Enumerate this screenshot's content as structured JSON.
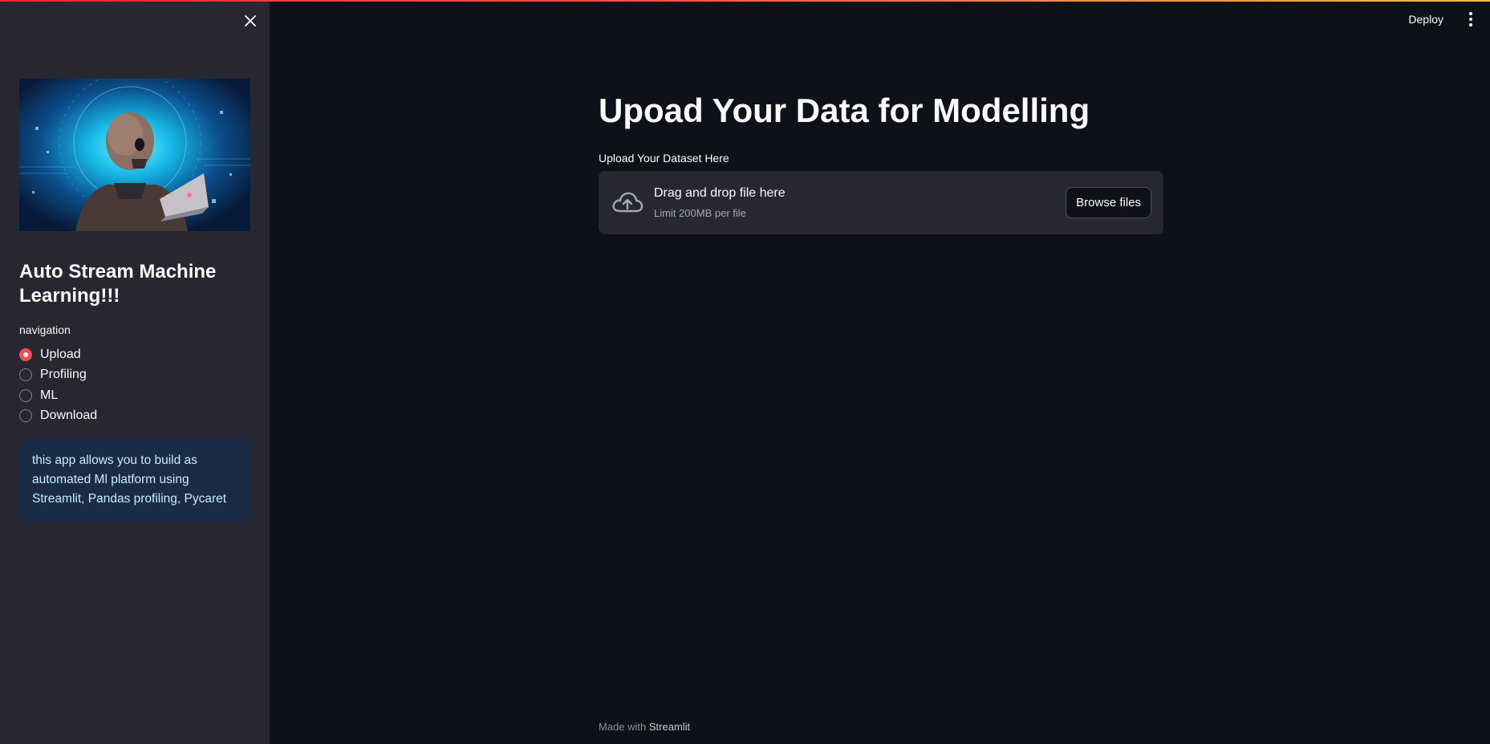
{
  "sidebar": {
    "close_icon": "close-icon",
    "hero_image": "robot-skull-laptop-illustration",
    "app_title": "Auto Stream Machine Learning!!!",
    "nav_label": "navigation",
    "nav_options": [
      {
        "label": "Upload",
        "selected": true
      },
      {
        "label": "Profiling",
        "selected": false
      },
      {
        "label": "ML",
        "selected": false
      },
      {
        "label": "Download",
        "selected": false
      }
    ],
    "info_text": "this app allows you to build as automated Ml platform using Streamlit, Pandas profiling, Pycaret"
  },
  "header": {
    "deploy_label": "Deploy",
    "menu_icon": "vertical-dots-icon"
  },
  "main": {
    "title": "Upoad Your Data for Modelling",
    "uploader": {
      "label": "Upload Your Dataset Here",
      "dropzone_text": "Drag and drop file here",
      "limit_text": "Limit 200MB per file",
      "button_label": "Browse files",
      "icon": "cloud-upload-icon"
    }
  },
  "footer": {
    "made_with": "Made with",
    "brand": "Streamlit"
  },
  "colors": {
    "background": "#0e1117",
    "sidebar": "#262730",
    "accent": "#ff4b4b",
    "info_bg": "#1c2b45",
    "info_text": "#c7ebff"
  }
}
